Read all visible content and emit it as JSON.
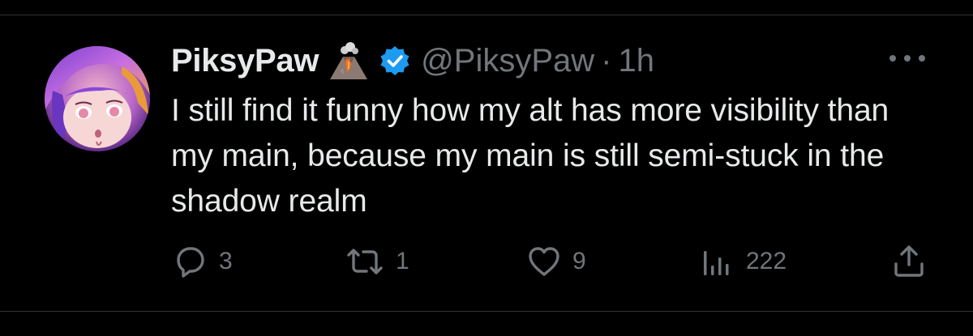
{
  "post": {
    "author": {
      "display_name": "PiksyPaw",
      "emoji_icon": "volcano-icon",
      "verified": true,
      "handle": "@PiksyPaw",
      "separator": "·",
      "timestamp": "1h"
    },
    "text": "I still find it funny how my alt has more visibility than my main, because my main is still semi-stuck in the shadow realm",
    "metrics": {
      "replies": "3",
      "reposts": "1",
      "likes": "9",
      "views": "222"
    }
  },
  "colors": {
    "background": "#000000",
    "text_primary": "#e7e9ea",
    "text_secondary": "#71767b",
    "verified_blue": "#1d9bf0",
    "divider": "#2f3336"
  }
}
